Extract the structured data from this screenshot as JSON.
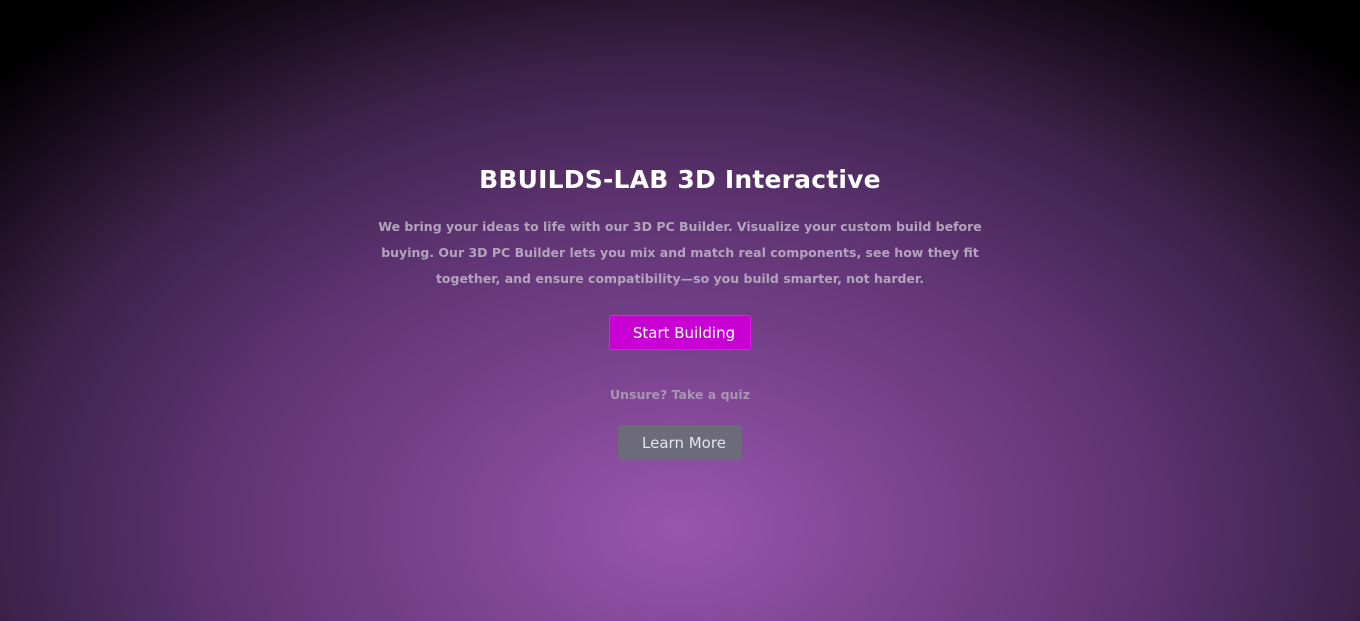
{
  "hero": {
    "title": "BBUILDS-LAB 3D Interactive",
    "description": "We bring your ideas to life with our 3D PC Builder. Visualize your custom build before buying. Our 3D PC Builder lets you mix and match real components, see how they fit together, and ensure compatibility—so you build smarter, not harder.",
    "primary_button_label": "Start Building",
    "quiz_prompt": "Unsure? Take a quiz",
    "secondary_button_label": "Learn More"
  },
  "colors": {
    "accent": "#c800d4",
    "secondary_button": "#6b6b79",
    "background_center": "#9a55ad",
    "background_edge": "#000000"
  }
}
